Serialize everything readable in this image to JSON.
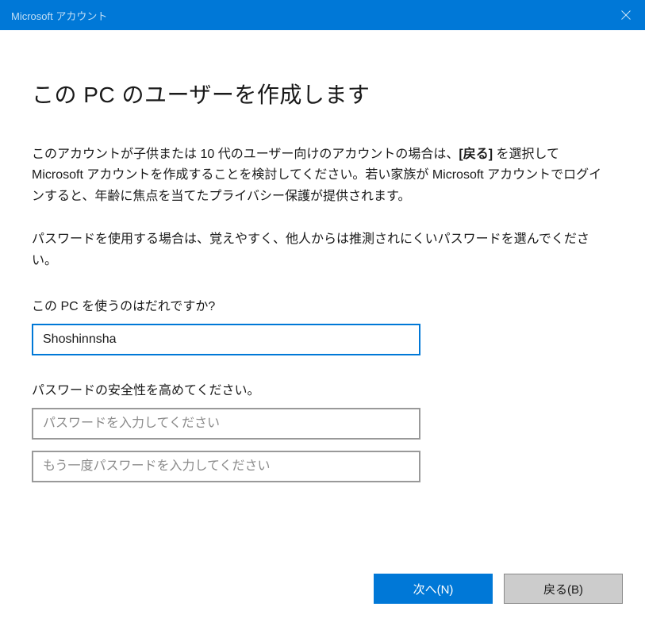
{
  "titlebar": {
    "title": "Microsoft アカウント"
  },
  "main": {
    "heading": "この PC のユーザーを作成します",
    "paragraph1_pre": "このアカウントが子供または 10 代のユーザー向けのアカウントの場合は、",
    "paragraph1_bold": "[戻る]",
    "paragraph1_post": " を選択して Microsoft アカウントを作成することを検討してください。若い家族が Microsoft アカウントでログインすると、年齢に焦点を当てたプライバシー保護が提供されます。",
    "paragraph2": "パスワードを使用する場合は、覚えやすく、他人からは推測されにくいパスワードを選んでください。",
    "username_label": "この PC を使うのはだれですか?",
    "username_value": "Shoshinnsha",
    "password_label": "パスワードの安全性を高めてください。",
    "password_placeholder": "パスワードを入力してください",
    "password_confirm_placeholder": "もう一度パスワードを入力してください"
  },
  "buttons": {
    "next": "次へ(N)",
    "back": "戻る(B)"
  }
}
